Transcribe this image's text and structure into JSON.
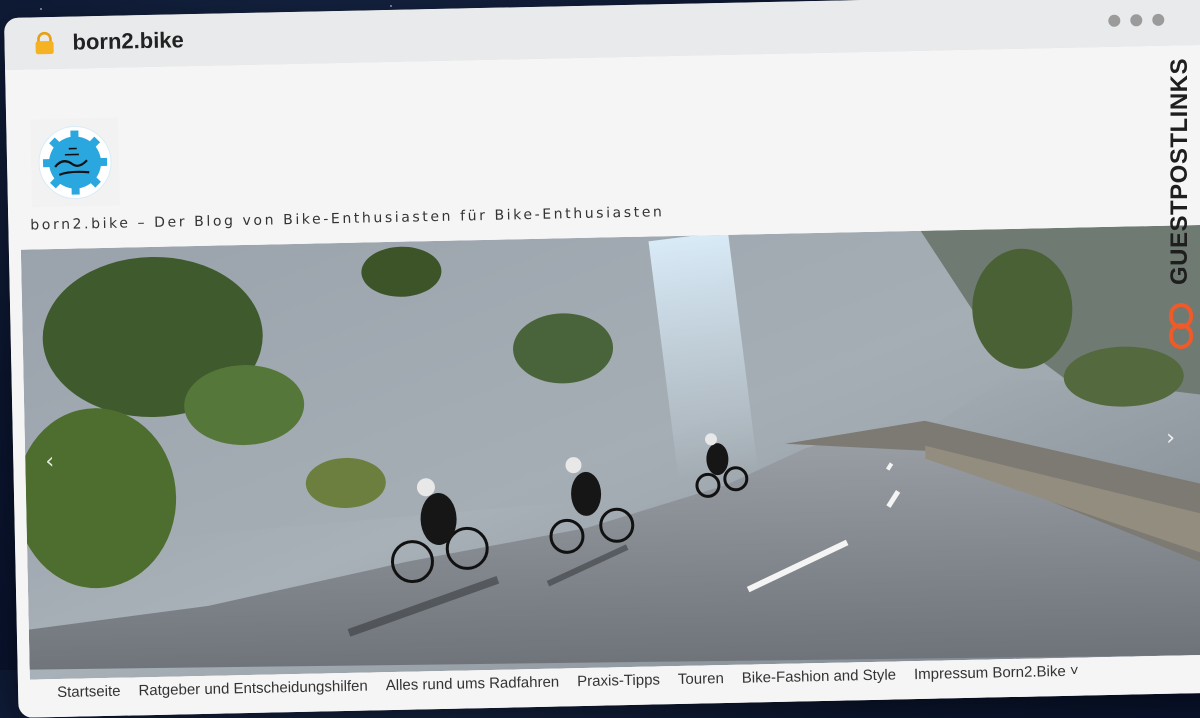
{
  "browser": {
    "url": "born2.bike"
  },
  "site": {
    "tagline": "born2.bike – Der Blog von Bike-Enthusiasten für Bike-Enthusiasten"
  },
  "hero": {
    "prev_icon": "chevron-left-icon",
    "next_icon": "chevron-right-icon"
  },
  "nav": {
    "items": [
      "Startseite",
      "Ratgeber und Entscheidungshilfen",
      "Alles rund ums Radfahren",
      "Praxis-Tipps",
      "Touren",
      "Bike-Fashion and Style",
      "Impressum Born2.Bike"
    ]
  },
  "badge": {
    "text": "GUESTPOSTLINKS",
    "accent": "#f05a28"
  },
  "colors": {
    "logo_blue": "#2aa7df",
    "page_bg": "#f5f5f5",
    "titlebar_bg": "#e9eaeb"
  }
}
